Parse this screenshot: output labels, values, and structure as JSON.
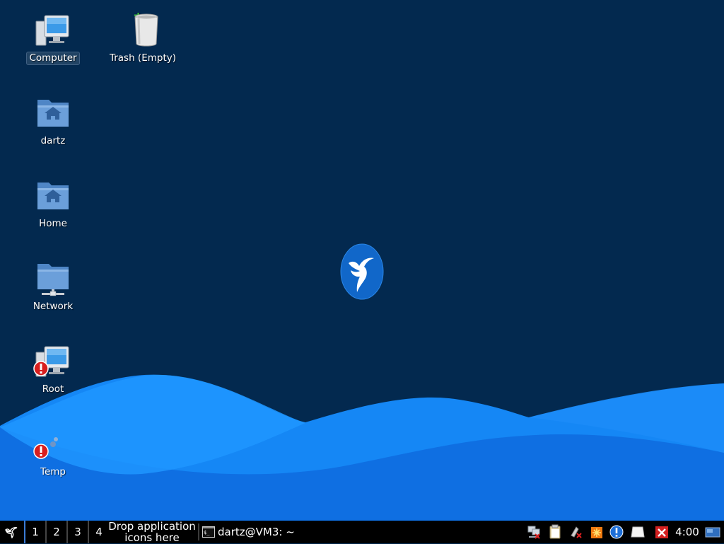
{
  "desktop": {
    "icons": [
      {
        "label": "Computer",
        "icon": "computer-icon",
        "selected": true
      },
      {
        "label": "Trash (Empty)",
        "icon": "trash-icon"
      },
      {
        "label": "dartz",
        "icon": "home-folder-icon"
      },
      {
        "label": "Home",
        "icon": "home-folder-icon"
      },
      {
        "label": "Network",
        "icon": "network-folder-icon"
      },
      {
        "label": "Root",
        "icon": "computer-error-icon"
      },
      {
        "label": "Temp",
        "icon": "temp-error-icon"
      }
    ],
    "logo": "hummingbird-logo"
  },
  "taskbar": {
    "menu_icon": "hummingbird-menu-icon",
    "workspaces": [
      "1",
      "2",
      "3",
      "4"
    ],
    "active_workspace": "1",
    "launcher_hint": "Drop application icons here",
    "window_title": "dartz@VM3: ~",
    "window_icon": "terminal-icon",
    "tray_icons": [
      "network-error-icon",
      "clipboard-icon",
      "mount-error-icon",
      "updates-icon",
      "info-icon",
      "blank-note-icon",
      "close-red-icon"
    ],
    "clock": "4:00",
    "show_desktop_icon": "show-desktop-icon"
  },
  "colors": {
    "background": "#03294f",
    "wave_light": "#1a8fff",
    "wave_mid": "#0f6ee0",
    "logo_blue": "#1167c9",
    "taskbar": "#000000"
  }
}
